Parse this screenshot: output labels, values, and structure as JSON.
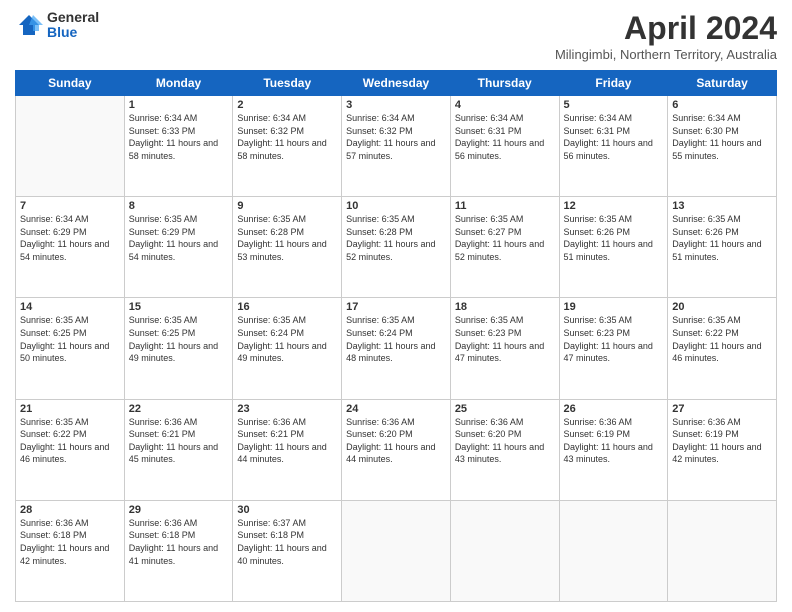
{
  "header": {
    "logo_general": "General",
    "logo_blue": "Blue",
    "title": "April 2024",
    "subtitle": "Milingimbi, Northern Territory, Australia"
  },
  "days_of_week": [
    "Sunday",
    "Monday",
    "Tuesday",
    "Wednesday",
    "Thursday",
    "Friday",
    "Saturday"
  ],
  "weeks": [
    [
      {
        "day": "",
        "sunrise": "",
        "sunset": "",
        "daylight": ""
      },
      {
        "day": "1",
        "sunrise": "Sunrise: 6:34 AM",
        "sunset": "Sunset: 6:33 PM",
        "daylight": "Daylight: 11 hours and 58 minutes."
      },
      {
        "day": "2",
        "sunrise": "Sunrise: 6:34 AM",
        "sunset": "Sunset: 6:32 PM",
        "daylight": "Daylight: 11 hours and 58 minutes."
      },
      {
        "day": "3",
        "sunrise": "Sunrise: 6:34 AM",
        "sunset": "Sunset: 6:32 PM",
        "daylight": "Daylight: 11 hours and 57 minutes."
      },
      {
        "day": "4",
        "sunrise": "Sunrise: 6:34 AM",
        "sunset": "Sunset: 6:31 PM",
        "daylight": "Daylight: 11 hours and 56 minutes."
      },
      {
        "day": "5",
        "sunrise": "Sunrise: 6:34 AM",
        "sunset": "Sunset: 6:31 PM",
        "daylight": "Daylight: 11 hours and 56 minutes."
      },
      {
        "day": "6",
        "sunrise": "Sunrise: 6:34 AM",
        "sunset": "Sunset: 6:30 PM",
        "daylight": "Daylight: 11 hours and 55 minutes."
      }
    ],
    [
      {
        "day": "7",
        "sunrise": "Sunrise: 6:34 AM",
        "sunset": "Sunset: 6:29 PM",
        "daylight": "Daylight: 11 hours and 54 minutes."
      },
      {
        "day": "8",
        "sunrise": "Sunrise: 6:35 AM",
        "sunset": "Sunset: 6:29 PM",
        "daylight": "Daylight: 11 hours and 54 minutes."
      },
      {
        "day": "9",
        "sunrise": "Sunrise: 6:35 AM",
        "sunset": "Sunset: 6:28 PM",
        "daylight": "Daylight: 11 hours and 53 minutes."
      },
      {
        "day": "10",
        "sunrise": "Sunrise: 6:35 AM",
        "sunset": "Sunset: 6:28 PM",
        "daylight": "Daylight: 11 hours and 52 minutes."
      },
      {
        "day": "11",
        "sunrise": "Sunrise: 6:35 AM",
        "sunset": "Sunset: 6:27 PM",
        "daylight": "Daylight: 11 hours and 52 minutes."
      },
      {
        "day": "12",
        "sunrise": "Sunrise: 6:35 AM",
        "sunset": "Sunset: 6:26 PM",
        "daylight": "Daylight: 11 hours and 51 minutes."
      },
      {
        "day": "13",
        "sunrise": "Sunrise: 6:35 AM",
        "sunset": "Sunset: 6:26 PM",
        "daylight": "Daylight: 11 hours and 51 minutes."
      }
    ],
    [
      {
        "day": "14",
        "sunrise": "Sunrise: 6:35 AM",
        "sunset": "Sunset: 6:25 PM",
        "daylight": "Daylight: 11 hours and 50 minutes."
      },
      {
        "day": "15",
        "sunrise": "Sunrise: 6:35 AM",
        "sunset": "Sunset: 6:25 PM",
        "daylight": "Daylight: 11 hours and 49 minutes."
      },
      {
        "day": "16",
        "sunrise": "Sunrise: 6:35 AM",
        "sunset": "Sunset: 6:24 PM",
        "daylight": "Daylight: 11 hours and 49 minutes."
      },
      {
        "day": "17",
        "sunrise": "Sunrise: 6:35 AM",
        "sunset": "Sunset: 6:24 PM",
        "daylight": "Daylight: 11 hours and 48 minutes."
      },
      {
        "day": "18",
        "sunrise": "Sunrise: 6:35 AM",
        "sunset": "Sunset: 6:23 PM",
        "daylight": "Daylight: 11 hours and 47 minutes."
      },
      {
        "day": "19",
        "sunrise": "Sunrise: 6:35 AM",
        "sunset": "Sunset: 6:23 PM",
        "daylight": "Daylight: 11 hours and 47 minutes."
      },
      {
        "day": "20",
        "sunrise": "Sunrise: 6:35 AM",
        "sunset": "Sunset: 6:22 PM",
        "daylight": "Daylight: 11 hours and 46 minutes."
      }
    ],
    [
      {
        "day": "21",
        "sunrise": "Sunrise: 6:35 AM",
        "sunset": "Sunset: 6:22 PM",
        "daylight": "Daylight: 11 hours and 46 minutes."
      },
      {
        "day": "22",
        "sunrise": "Sunrise: 6:36 AM",
        "sunset": "Sunset: 6:21 PM",
        "daylight": "Daylight: 11 hours and 45 minutes."
      },
      {
        "day": "23",
        "sunrise": "Sunrise: 6:36 AM",
        "sunset": "Sunset: 6:21 PM",
        "daylight": "Daylight: 11 hours and 44 minutes."
      },
      {
        "day": "24",
        "sunrise": "Sunrise: 6:36 AM",
        "sunset": "Sunset: 6:20 PM",
        "daylight": "Daylight: 11 hours and 44 minutes."
      },
      {
        "day": "25",
        "sunrise": "Sunrise: 6:36 AM",
        "sunset": "Sunset: 6:20 PM",
        "daylight": "Daylight: 11 hours and 43 minutes."
      },
      {
        "day": "26",
        "sunrise": "Sunrise: 6:36 AM",
        "sunset": "Sunset: 6:19 PM",
        "daylight": "Daylight: 11 hours and 43 minutes."
      },
      {
        "day": "27",
        "sunrise": "Sunrise: 6:36 AM",
        "sunset": "Sunset: 6:19 PM",
        "daylight": "Daylight: 11 hours and 42 minutes."
      }
    ],
    [
      {
        "day": "28",
        "sunrise": "Sunrise: 6:36 AM",
        "sunset": "Sunset: 6:18 PM",
        "daylight": "Daylight: 11 hours and 42 minutes."
      },
      {
        "day": "29",
        "sunrise": "Sunrise: 6:36 AM",
        "sunset": "Sunset: 6:18 PM",
        "daylight": "Daylight: 11 hours and 41 minutes."
      },
      {
        "day": "30",
        "sunrise": "Sunrise: 6:37 AM",
        "sunset": "Sunset: 6:18 PM",
        "daylight": "Daylight: 11 hours and 40 minutes."
      },
      {
        "day": "",
        "sunrise": "",
        "sunset": "",
        "daylight": ""
      },
      {
        "day": "",
        "sunrise": "",
        "sunset": "",
        "daylight": ""
      },
      {
        "day": "",
        "sunrise": "",
        "sunset": "",
        "daylight": ""
      },
      {
        "day": "",
        "sunrise": "",
        "sunset": "",
        "daylight": ""
      }
    ]
  ]
}
